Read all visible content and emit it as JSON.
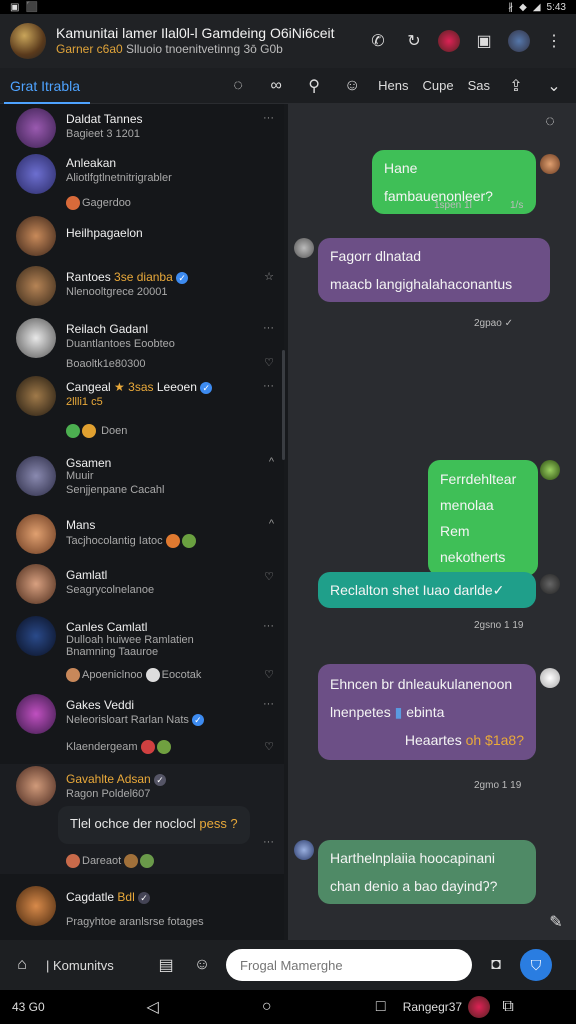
{
  "status_bar": {
    "left": "▣",
    "right": "5:43"
  },
  "header": {
    "title": "Kamunitai lamer Ilal0l-l Gamdeing O6iNi6ceit",
    "sub_accent": "Garner c6a0",
    "sub_rest": "Slluoio tnoenitvetinng 3ō G0b"
  },
  "tabs": {
    "active": "Grat Itrabla",
    "items": [
      "Hens",
      "Cupe",
      "Sas"
    ]
  },
  "chats": [
    {
      "name": "Daldat Tannes",
      "line": "Bagieet 3 1201",
      "meta": "···"
    },
    {
      "name": "Anleakan",
      "line": "Aliotlfgtlnetnitrigrabler",
      "sub": "Gagerdoo",
      "meta": ""
    },
    {
      "name": "Heilhpagaelon",
      "line": "",
      "meta": ""
    },
    {
      "name": "Rantoes",
      "name_gold": "3se dianba",
      "line": "Nlenooltgrece 20001",
      "meta": "☆"
    },
    {
      "name": "Reilach Gadanl",
      "line": "Duantlantoes Eoobteo",
      "sub": "Boaoltk1e80300",
      "meta": "···"
    },
    {
      "name": "Cangeal",
      "name_gold": "3sas",
      "name_rest": "Leeoen",
      "line": "2llli1 c5",
      "sub": "Doen",
      "meta": "···"
    },
    {
      "name": "Gsamen",
      "line": "Muuir",
      "line2": "Senjjenpane Cacahl",
      "meta": "^"
    },
    {
      "name": "Mans",
      "line": "Tacjhocolantig Iatoc",
      "meta": "^"
    },
    {
      "name": "Gamlatl",
      "line": "Seagrycolnelanoe",
      "meta": "♡"
    },
    {
      "name": "Canles Camlatl",
      "line": "Dulloah huiwee Ramlatien",
      "line2": "Bnamning Taauroe",
      "sub": "Apoeniclnoo",
      "sub2": "Eocotak",
      "meta": "···"
    },
    {
      "name": "Gakes Veddi",
      "line": "Neleorisloart Rarlan Nats",
      "sub": "Klaendergeam",
      "meta": "···"
    },
    {
      "name": "Gavahlte Adsan",
      "line": "Ragon Poldel607",
      "preview": "Tlel ochce der noclocl",
      "preview_gold": "pess ?",
      "sub": "Dareaot",
      "meta": ""
    },
    {
      "name": "Cagdatle",
      "name_gold": "Bdl",
      "line": "Pragyhtoe aranlsrse fotages",
      "meta": ""
    }
  ],
  "messages": [
    {
      "text": "Hane fambauenonleer?",
      "time": "1spen 1l",
      "time2": "1/s"
    },
    {
      "text1": "Fagorr dlnatad",
      "text2": "maacb langighalahaconantus",
      "time": "2gpao"
    },
    {
      "text1": "Ferrdehltear",
      "text2": "menolaa Rem",
      "text3": "nekotherts",
      "time": ""
    },
    {
      "text": "Reclalton shet Iuao darlde✓",
      "time": "2gsno 1 19"
    },
    {
      "text1": "Ehncen br dnleaukulanenoon",
      "text2": "lnenpetes",
      "text2b": "ebinta",
      "text3": "Heaartes",
      "text3_gold": "oh $1a8?",
      "time": "2gmo 1 19"
    },
    {
      "text1": "Harthelnplaiia hoocapinani",
      "text2": "chan denio a bao dayindʔ?"
    }
  ],
  "input": {
    "label": "Komunitvs",
    "placeholder": "Frogal Mamerghe"
  },
  "nav": {
    "left": "43 G0",
    "right": "Rangegr37"
  }
}
